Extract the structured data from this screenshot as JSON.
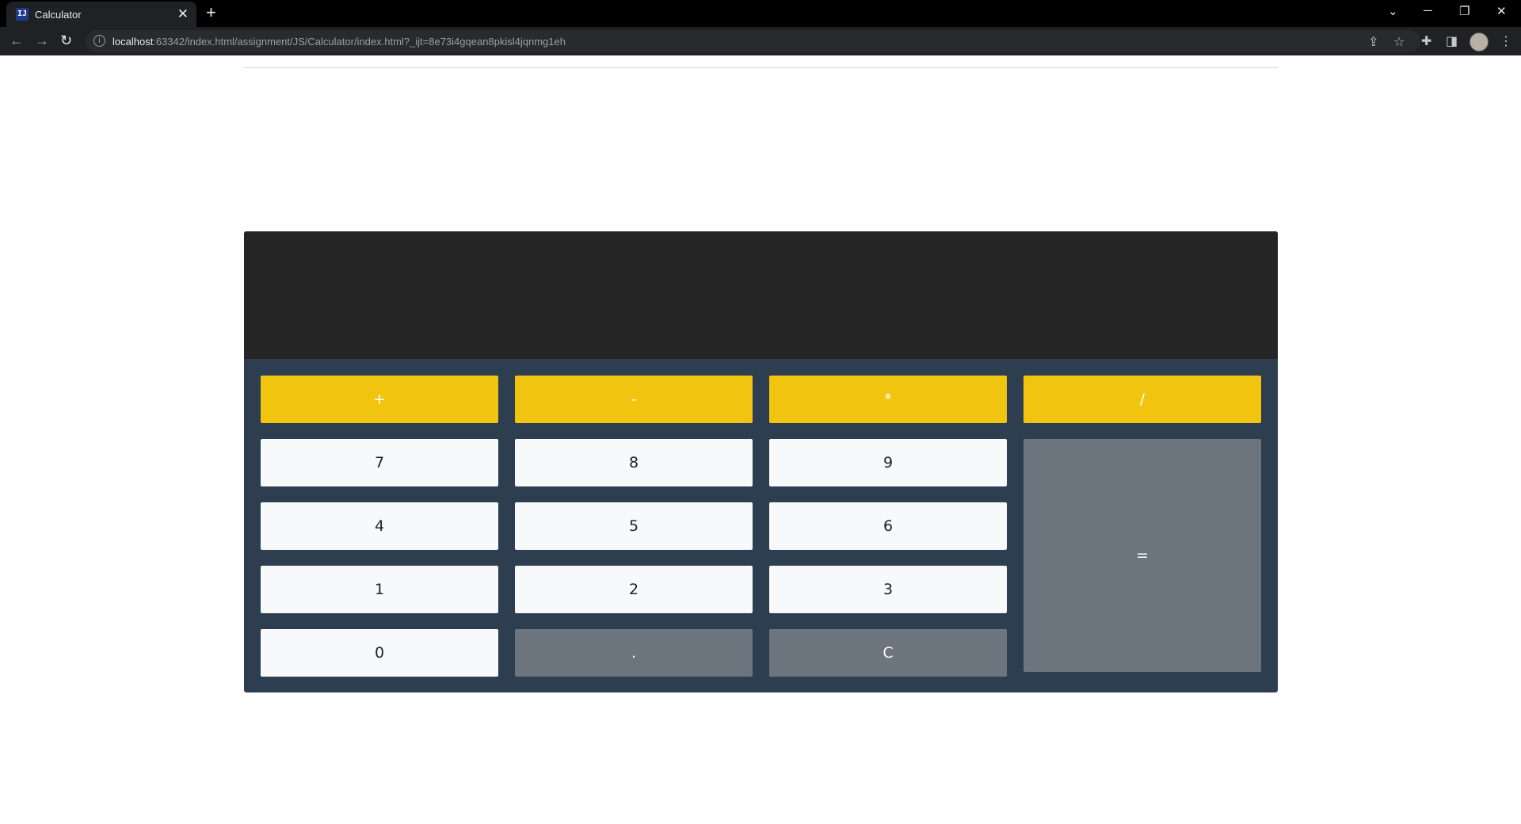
{
  "browser": {
    "tab_title": "Calculator",
    "favicon_text": "IJ",
    "url_host": "localhost",
    "url_rest": ":63342/index.html/assignment/JS/Calculator/index.html?_ijt=8e73i4gqean8pkisl4jqnmg1eh"
  },
  "calculator": {
    "display": "",
    "colors": {
      "operator": "#f1c40f",
      "number": "#f8f9fa",
      "secondary": "#6c757d",
      "body": "#2c3e50",
      "display": "#252525"
    },
    "keys": {
      "add": "+",
      "subtract": "-",
      "multiply": "*",
      "divide": "/",
      "seven": "7",
      "eight": "8",
      "nine": "9",
      "four": "4",
      "five": "5",
      "six": "6",
      "one": "1",
      "two": "2",
      "three": "3",
      "zero": "0",
      "decimal": ".",
      "clear": "C",
      "equals": "="
    }
  }
}
